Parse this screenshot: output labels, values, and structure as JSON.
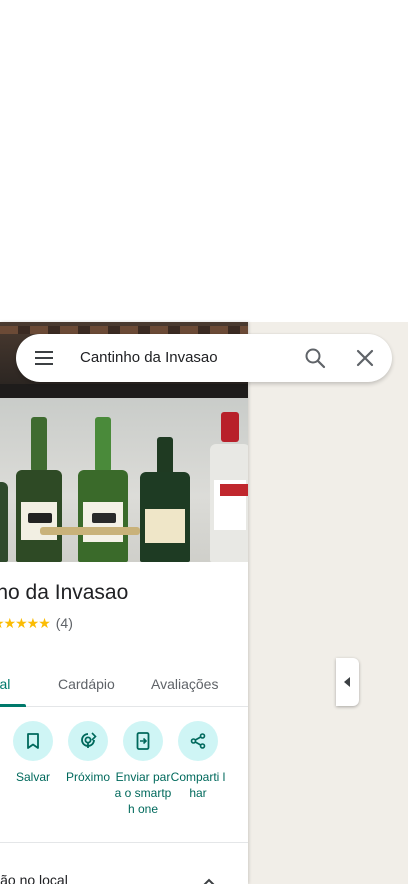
{
  "search": {
    "query": "Cantinho da Invasao"
  },
  "place": {
    "title": "inho da Invasao",
    "stars": "★★★★★",
    "review_count": "(4)"
  },
  "tabs": [
    {
      "label": "eral"
    },
    {
      "label": "Cardápio"
    },
    {
      "label": "Avaliações"
    }
  ],
  "actions": [
    {
      "label": "Salvar",
      "icon": "bookmark-icon"
    },
    {
      "label": "Próximo",
      "icon": "nearby-icon"
    },
    {
      "label": "Enviar para o smartph one",
      "icon": "send-to-phone-icon"
    },
    {
      "label": "Comparti lhar",
      "icon": "share-icon"
    }
  ],
  "info": {
    "label": "ição no local"
  },
  "colors": {
    "accent": "#00796b",
    "action_bg": "#cff5f5",
    "star": "#fbbc04",
    "map": "#f1eee8"
  }
}
